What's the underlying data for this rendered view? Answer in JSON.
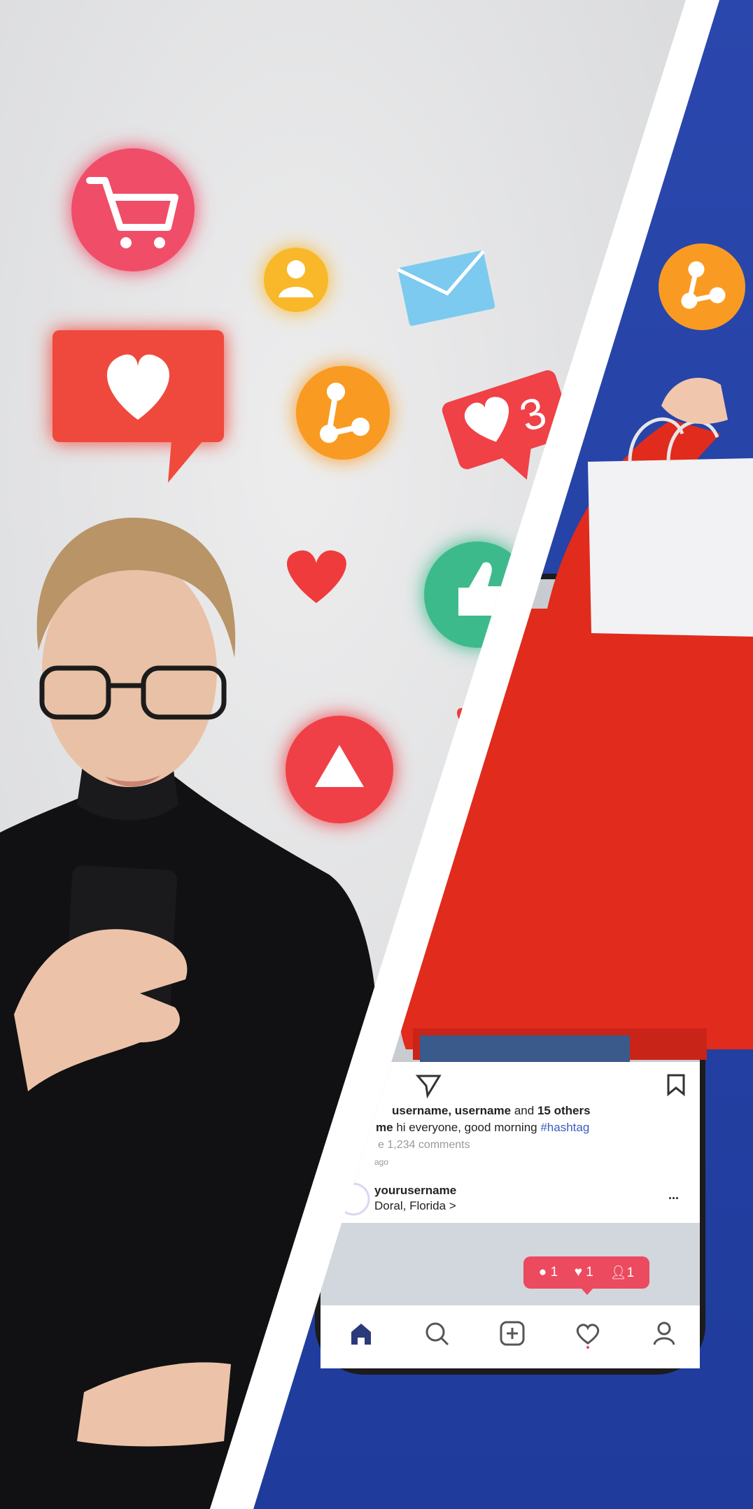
{
  "feed": {
    "likes_prefix": "username, username",
    "likes_and": "and",
    "likes_others": "15 others",
    "caption_user": "me",
    "caption_text": "hi everyone, good morning",
    "caption_hashtag": "#hashtag",
    "comments": "e 1,234 comments",
    "time_ago": "ago",
    "post_username": "yourusername",
    "post_location": "Doral, Florida >",
    "more": "..."
  },
  "notification": {
    "comments_count": "1",
    "likes_count": "1",
    "followers_count": "1"
  },
  "heart_badge_count": "3",
  "colors": {
    "blue_bg": "#2343a6",
    "red_sweater": "#e02b1d",
    "accent_red": "#ef4146",
    "orange": "#f99b22",
    "pink": "#f04e68",
    "green": "#3cba8c",
    "notif_pink": "#ec4a5f"
  }
}
